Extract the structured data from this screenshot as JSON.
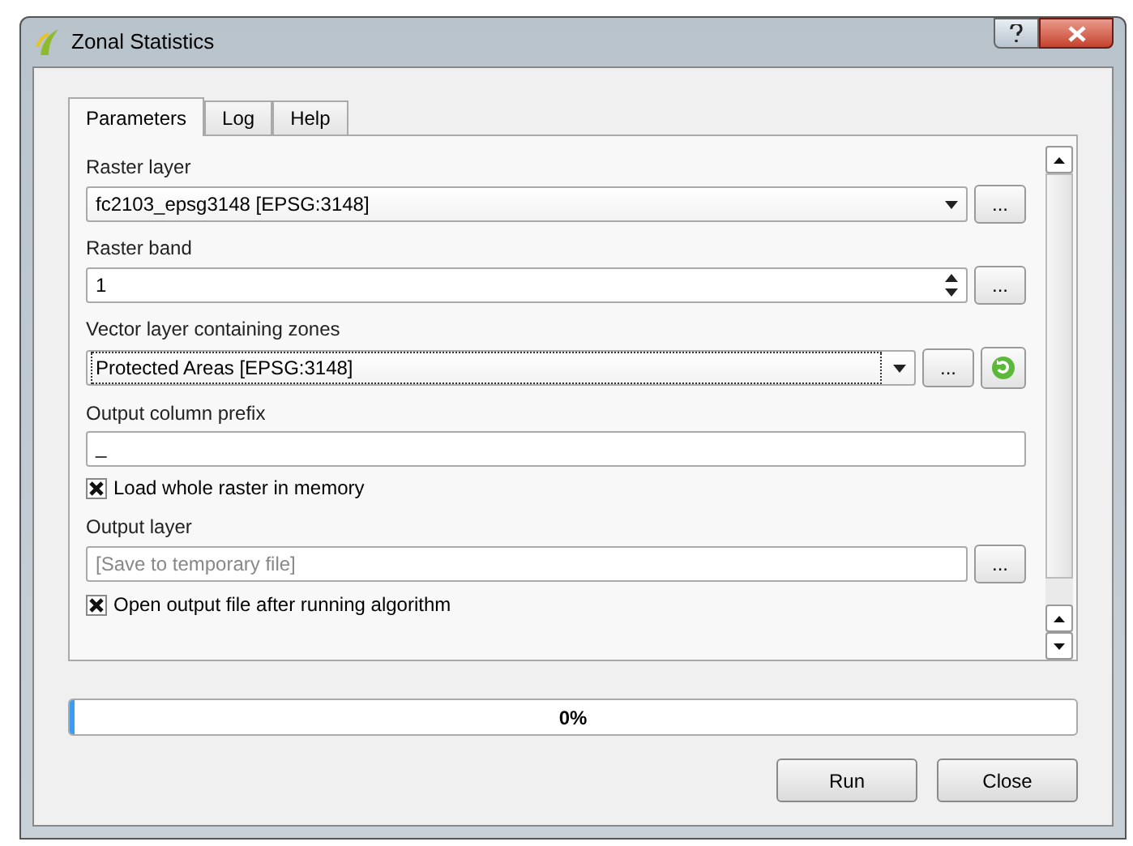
{
  "window": {
    "title": "Zonal Statistics"
  },
  "tabs": [
    {
      "label": "Parameters",
      "selected": true
    },
    {
      "label": "Log",
      "selected": false
    },
    {
      "label": "Help",
      "selected": false
    }
  ],
  "params": [
    {
      "kind": "label",
      "text": "Raster layer"
    },
    {
      "kind": "combo",
      "value": "fc2103_epsg3148 [EPSG:3148]",
      "focused": false,
      "dots": "..."
    },
    {
      "kind": "label",
      "text": "Raster band"
    },
    {
      "kind": "spin",
      "value": "1",
      "dots": "..."
    },
    {
      "kind": "label",
      "text": "Vector layer containing zones"
    },
    {
      "kind": "combo",
      "value": "Protected Areas [EPSG:3148]",
      "focused": true,
      "dots": "...",
      "refresh": true
    },
    {
      "kind": "label",
      "text": "Output column prefix"
    },
    {
      "kind": "text",
      "value": "_"
    },
    {
      "kind": "checkbox",
      "text": "Load whole raster in memory",
      "checked": true
    },
    {
      "kind": "label",
      "text": "Output layer"
    },
    {
      "kind": "output",
      "placeholder": "[Save to temporary file]",
      "dots": "..."
    },
    {
      "kind": "checkbox",
      "text": "Open output file after running algorithm",
      "checked": true
    }
  ],
  "progress": {
    "level": 0,
    "text": "0%"
  },
  "buttons": [
    "Run",
    "Close"
  ]
}
